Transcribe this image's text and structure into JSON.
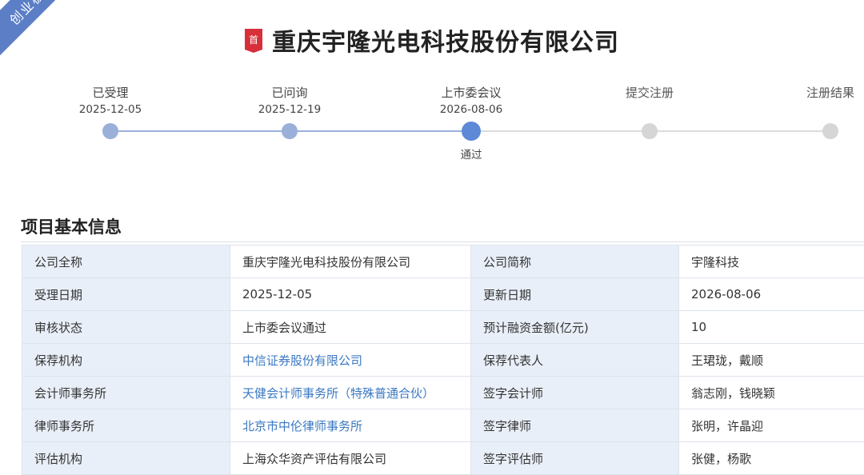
{
  "ribbon": {
    "label": "创业板"
  },
  "header": {
    "badge_label": "首",
    "company_name": "重庆宇隆光电科技股份有限公司"
  },
  "timeline": {
    "steps": [
      {
        "label": "已受理",
        "date": "2025-12-05",
        "status": "done",
        "note": ""
      },
      {
        "label": "已问询",
        "date": "2025-12-19",
        "status": "done",
        "note": ""
      },
      {
        "label": "上市委会议",
        "date": "2026-08-06",
        "status": "current",
        "note": "通过"
      },
      {
        "label": "提交注册",
        "date": "",
        "status": "pending",
        "note": ""
      },
      {
        "label": "注册结果",
        "date": "",
        "status": "pending",
        "note": ""
      }
    ],
    "colors": {
      "done": "#9ab0d9",
      "current": "#5d89d6",
      "pending": "#d6d6d6"
    }
  },
  "section": {
    "title": "项目基本信息"
  },
  "info_table": {
    "rows": [
      {
        "k1": "公司全称",
        "v1": "重庆宇隆光电科技股份有限公司",
        "v1_link": false,
        "k2": "公司简称",
        "v2": "宇隆科技"
      },
      {
        "k1": "受理日期",
        "v1": "2025-12-05",
        "v1_link": false,
        "k2": "更新日期",
        "v2": "2026-08-06"
      },
      {
        "k1": "审核状态",
        "v1": "上市委会议通过",
        "v1_link": false,
        "k2": "预计融资金额(亿元)",
        "v2": "10"
      },
      {
        "k1": "保荐机构",
        "v1": "中信证券股份有限公司",
        "v1_link": true,
        "k2": "保荐代表人",
        "v2": "王珺珑，戴顺"
      },
      {
        "k1": "会计师事务所",
        "v1": "天健会计师事务所（特殊普通合伙）",
        "v1_link": true,
        "k2": "签字会计师",
        "v2": "翁志刚，钱晓颖"
      },
      {
        "k1": "律师事务所",
        "v1": "北京市中伦律师事务所",
        "v1_link": true,
        "k2": "签字律师",
        "v2": "张明，许晶迎"
      },
      {
        "k1": "评估机构",
        "v1": "上海众华资产评估有限公司",
        "v1_link": false,
        "k2": "签字评估师",
        "v2": "张健，杨歌"
      }
    ]
  }
}
